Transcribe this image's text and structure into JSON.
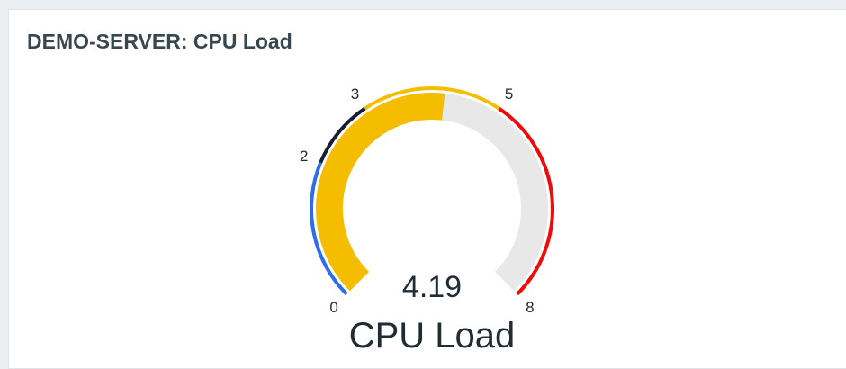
{
  "widget": {
    "title": "DEMO-SERVER: CPU Load"
  },
  "gauge": {
    "value": 4.19,
    "value_label": "4.19",
    "description": "CPU Load",
    "min": 0,
    "max": 8,
    "colors": {
      "value_arc": "#f5bd00",
      "empty_arc": "#e8e8e8",
      "text": "#1f2c33"
    },
    "thresholds": [
      {
        "from": 0,
        "to": 2,
        "color": "#2a6ee8"
      },
      {
        "from": 2,
        "to": 3,
        "color": "#17202e"
      },
      {
        "from": 3,
        "to": 5,
        "color": "#f5bd00"
      },
      {
        "from": 5,
        "to": 8,
        "color": "#f00a0a"
      }
    ],
    "scale_labels": [
      "0",
      "2",
      "3",
      "5",
      "8"
    ]
  }
}
